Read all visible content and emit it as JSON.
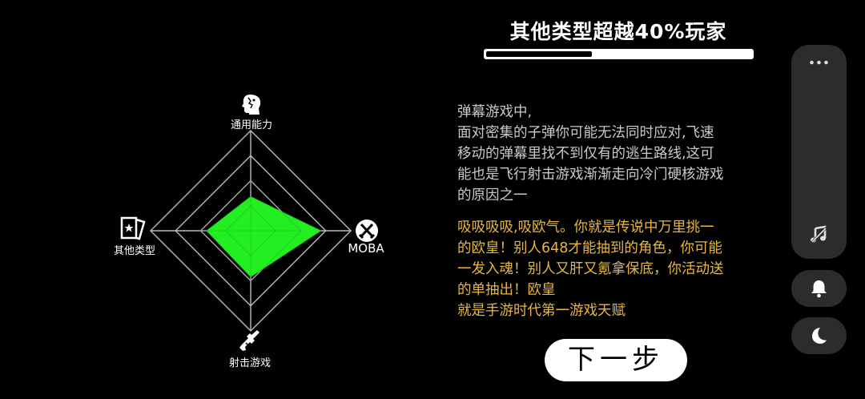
{
  "header": {
    "title": "其他类型超越40%玩家",
    "progress_fraction": 0.4
  },
  "radar": {
    "axes": [
      {
        "label": "通用能力",
        "icon": "head-profile-icon",
        "value": 0.34
      },
      {
        "label": "MOBA",
        "icon": "crossed-swords-icon",
        "value": 0.7
      },
      {
        "label": "射击游戏",
        "icon": "gun-icon",
        "value": 0.46
      },
      {
        "label": "其他类型",
        "icon": "card-icon",
        "value": 0.44
      }
    ],
    "fill_color": "#22ee22",
    "grid_color": "#bbbbbb"
  },
  "description": {
    "lines": [
      "弹幕游戏中,",
      "面对密集的子弹你可能无法同时应对,飞速",
      "移动的弹幕里找不到仅有的逃生路线,这可",
      "能也是飞行射击游戏渐渐走向冷门硬核游戏",
      "的原因之一"
    ]
  },
  "highlight": {
    "lines": [
      "吸吸吸吸,吸欧气。你就是传说中万里挑一",
      "的欧皇！别人648才能抽到的角色，你可能",
      "一发入魂！别人又肝又氪拿保底，你活动送",
      "的单抽出！欧皇",
      "就是手游时代第一游戏天赋"
    ],
    "color": "#e8b73f"
  },
  "next_button": {
    "label": "下一步"
  },
  "side_panel": {
    "icons": [
      "more-dots-icon",
      "music-off-icon",
      "bell-icon",
      "moon-icon"
    ]
  }
}
